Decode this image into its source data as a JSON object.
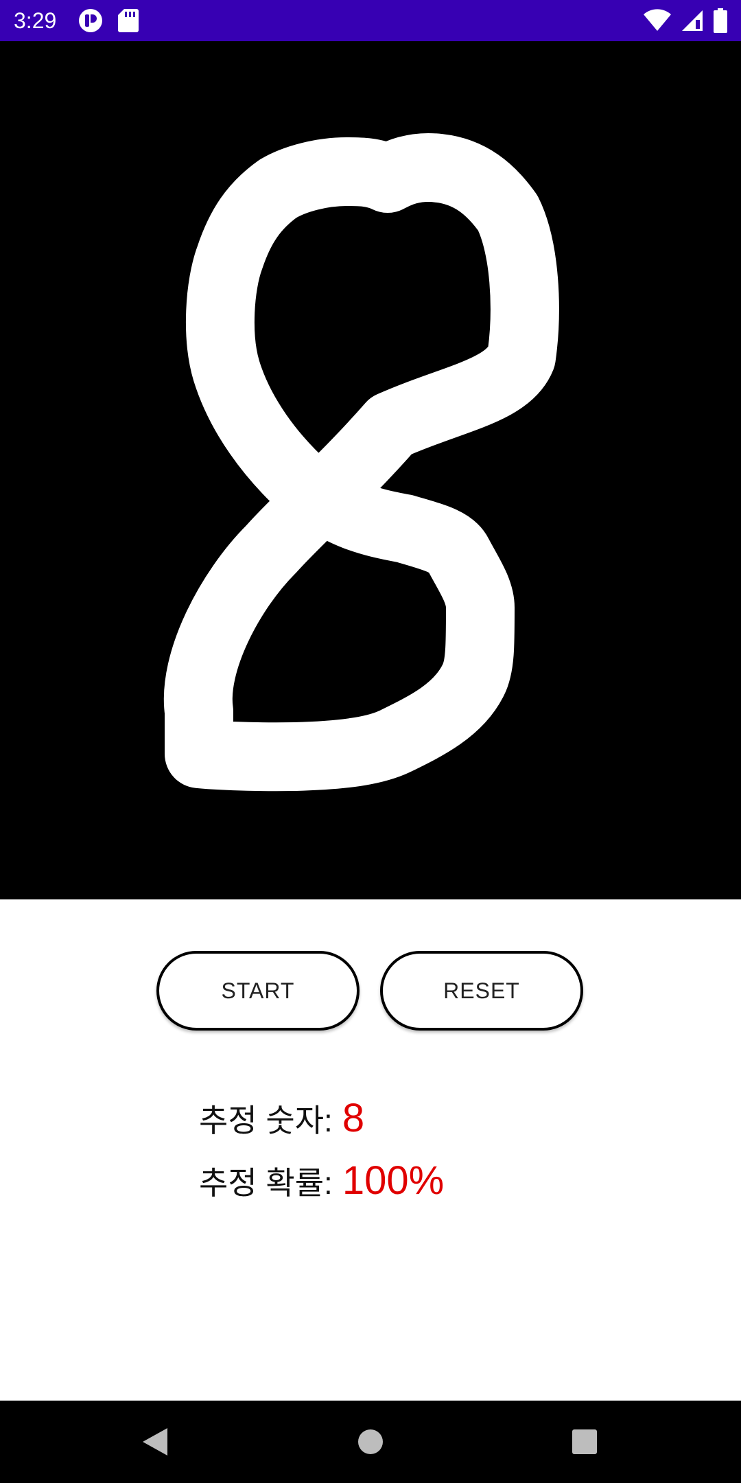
{
  "status_bar": {
    "time": "3:29",
    "background": "#3700b3",
    "left_icons": [
      "app-notification-icon",
      "sd-card-icon"
    ],
    "right_icons": [
      "wifi-icon",
      "cell-signal-icon",
      "battery-icon"
    ]
  },
  "canvas": {
    "background": "#000000",
    "stroke_color": "#ffffff",
    "drawn_digit": "8"
  },
  "buttons": {
    "start_label": "START",
    "reset_label": "RESET"
  },
  "results": {
    "digit_label": "추정 숫자:",
    "digit_value": "8",
    "probability_label": "추정 확률:",
    "probability_value": "100%",
    "value_color": "#e00000"
  },
  "nav_bar": {
    "icons": [
      "back-icon",
      "home-icon",
      "recents-icon"
    ]
  }
}
